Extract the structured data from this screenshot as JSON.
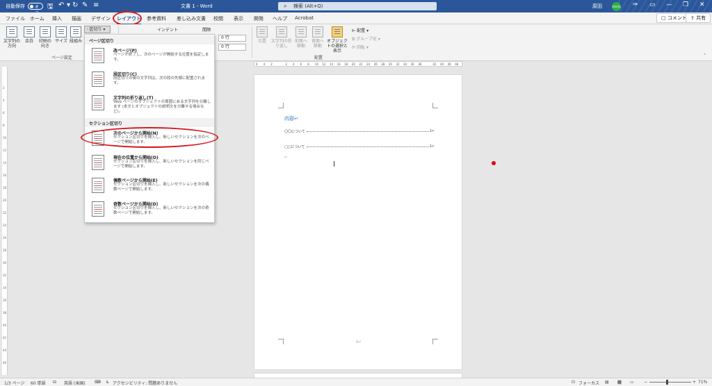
{
  "titlebar": {
    "autosave_label": "自動保存",
    "autosave_state": "オフ",
    "doc_title": "文書 1  -  Word",
    "search_placeholder": "検索 (Alt+Q)",
    "user_name": "原田",
    "user_initials": "sherly"
  },
  "tabs": [
    "ファイル",
    "ホーム",
    "挿入",
    "描画",
    "デザイン",
    "レイアウト",
    "参考資料",
    "差し込み文書",
    "校閲",
    "表示",
    "開発",
    "ヘルプ",
    "Acrobat"
  ],
  "active_tab": "レイアウト",
  "actions": {
    "comment": "コメント",
    "share": "共有"
  },
  "ribbon": {
    "page_setup": {
      "buttons": [
        "文字列の方向",
        "余白",
        "印刷の向き",
        "サイズ",
        "段組み"
      ],
      "breaks_button": "区切り",
      "label": "ページ設定"
    },
    "indent_label": "インデント",
    "spacing_label": "間隔",
    "spin_before": "0 行",
    "spin_after": "0 行",
    "arrange": {
      "buttons": [
        "位置",
        "文字列の折り返し",
        "前面へ移動",
        "背面へ移動",
        "オブジェクトの選択と表示"
      ],
      "align": "配置",
      "group": "グループ化",
      "rotate": "回転",
      "label": "配置"
    }
  },
  "breaks_menu": {
    "page_breaks_header": "ページ区切り",
    "section_breaks_header": "セクション区切り",
    "items": [
      {
        "title": "改ページ(P)",
        "desc": "ページが終了し、次のページが開始する位置を指定します。"
      },
      {
        "title": "段区切り(C)",
        "desc": "段区切りの後の文字列は、次の段の先頭に配置されます。"
      },
      {
        "title": "文字列の折り返し(T)",
        "desc": "Web ページのオブジェクトの周囲にある文字列を分離します (本文とオブジェクトの説明文を分離する場合など)。"
      },
      {
        "title": "次のページから開始(N)",
        "desc": "セクション区切りを挿入し、新しいセクションを次のページで開始します。"
      },
      {
        "title": "現在の位置から開始(O)",
        "desc": "セクション区切りを挿入し、新しいセクションを同じページで開始します。"
      },
      {
        "title": "偶数ページから開始(E)",
        "desc": "セクション区切りを挿入し、新しいセクションを次の偶数ページで開始します。"
      },
      {
        "title": "奇数ページから開始(D)",
        "desc": "セクション区切りを挿入し、新しいセクションを次の奇数ページで開始します。"
      }
    ]
  },
  "ruler_ticks": [
    "6",
    "4",
    "2",
    "",
    "2",
    "4",
    "6",
    "8",
    "10",
    "12",
    "14",
    "16",
    "18",
    "20",
    "22",
    "24",
    "26",
    "28",
    "30",
    "32",
    "34",
    "36",
    "38",
    "",
    "42",
    "44",
    "46",
    "48"
  ],
  "vruler_ticks": [
    "2",
    "4",
    "6",
    "8",
    "10",
    "12",
    "14",
    "16",
    "18",
    "20",
    "22",
    "24",
    "26",
    "28",
    "30",
    "32",
    "34",
    "36",
    "38",
    "40",
    "42",
    "44",
    "46"
  ],
  "document": {
    "toc_heading": "内容↵",
    "toc_rows": [
      {
        "label": "〇〇について",
        "page": "1↵"
      },
      {
        "label": "□□について",
        "page": "1↵"
      }
    ],
    "paragraph_mark": "↵",
    "footer_mark": "1↵"
  },
  "statusbar": {
    "page": "1/3 ページ",
    "words": "60 単語",
    "language": "英語 (米国)",
    "accessibility": "アクセシビリティ: 問題ありません",
    "focus": "フォーカス",
    "zoom": "71%"
  }
}
